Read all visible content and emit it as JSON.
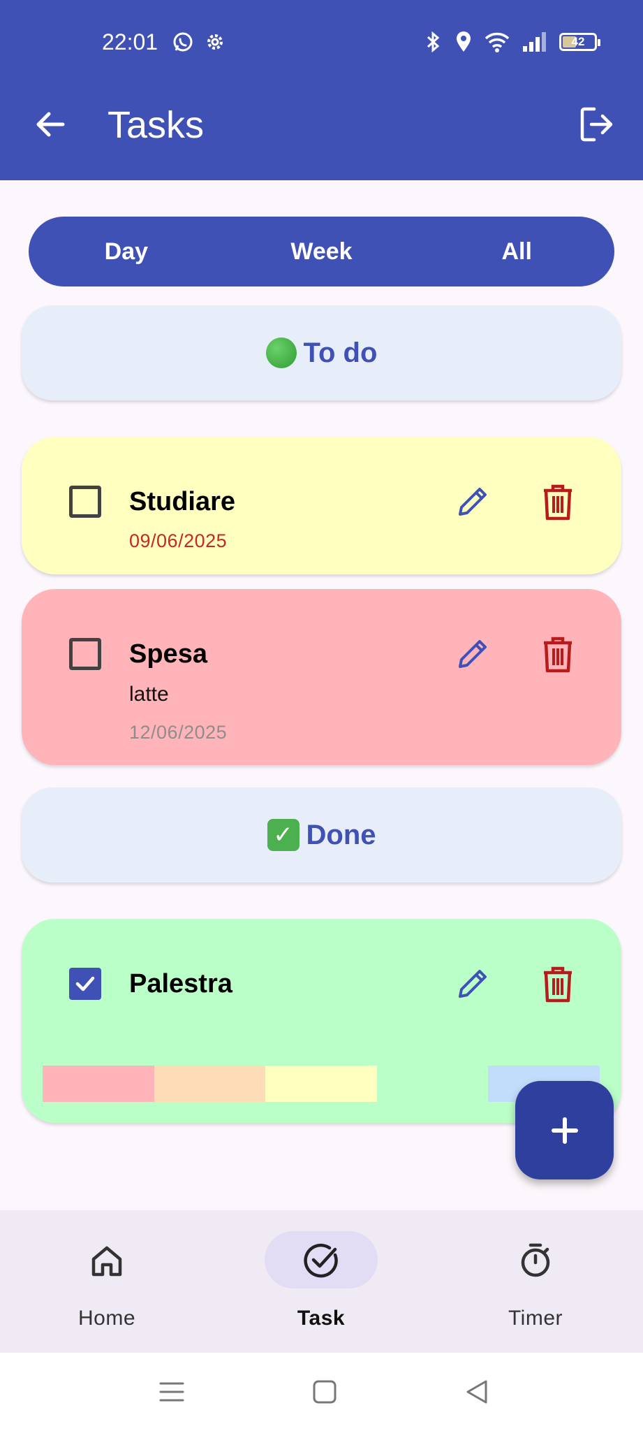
{
  "status_bar": {
    "time": "22:01",
    "left_icons": [
      "whatsapp-icon",
      "settings-icon"
    ],
    "right_icons": [
      "bluetooth-icon",
      "location-icon",
      "wifi-icon",
      "signal-icon"
    ],
    "battery_level": "42"
  },
  "app_bar": {
    "title": "Tasks",
    "back_icon": "arrow-left-icon",
    "logout_icon": "logout-icon"
  },
  "filter": {
    "options": [
      "Day",
      "Week",
      "All"
    ]
  },
  "sections": {
    "todo_label": "To do",
    "done_label": "Done"
  },
  "tasks_todo": [
    {
      "title": "Studiare",
      "description": "",
      "date": "09/06/2025",
      "checked": false,
      "bg_color": "#ffffbf",
      "date_color": "#c62828"
    },
    {
      "title": "Spesa",
      "description": "latte",
      "date": "12/06/2025",
      "checked": false,
      "bg_color": "#ffb4b9",
      "date_color": "#8d8d8d"
    }
  ],
  "tasks_done": [
    {
      "title": "Palestra",
      "checked": true,
      "bg_color": "#bbffc8"
    }
  ],
  "color_palette": [
    "#ffb4b9",
    "#ffdcb8",
    "#ffffbf",
    "#bbffc8",
    "#c2ddfb"
  ],
  "colors": {
    "primary": "#3f51b5",
    "edit_icon": "#3f51b5",
    "delete_icon": "#b71c1c"
  },
  "fab": {
    "icon": "plus-icon"
  },
  "bottom_nav": {
    "items": [
      {
        "label": "Home",
        "icon": "home-icon",
        "active": false
      },
      {
        "label": "Task",
        "icon": "check-circle-icon",
        "active": true
      },
      {
        "label": "Timer",
        "icon": "stopwatch-icon",
        "active": false
      }
    ]
  },
  "system_nav": [
    "menu-icon",
    "home-square-icon",
    "back-triangle-icon"
  ]
}
